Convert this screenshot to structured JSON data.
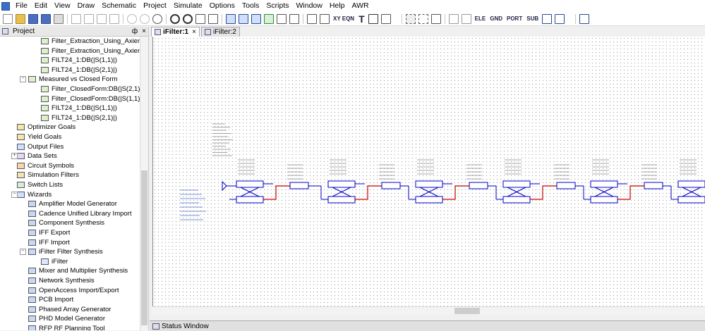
{
  "menu": [
    "File",
    "Edit",
    "View",
    "Draw",
    "Schematic",
    "Project",
    "Simulate",
    "Options",
    "Tools",
    "Scripts",
    "Window",
    "Help",
    "AWR"
  ],
  "toolbar": {
    "xy_label": "XY EQN",
    "text_label": "T",
    "ele_label": "ELE",
    "gnd_label": "GND",
    "port_label": "PORT",
    "sub_label": "SUB"
  },
  "project_panel": {
    "title": "Project",
    "pin": "ф",
    "close": "×",
    "tree": [
      {
        "label": "Filter_Extraction_Using_Axiem:DE",
        "icon": "graph-icon",
        "indent": 2
      },
      {
        "label": "Filter_Extraction_Using_Axiem:DE",
        "icon": "graph-icon",
        "indent": 2
      },
      {
        "label": "FILT24_1:DB(|S(1,1)|)",
        "icon": "graph-icon",
        "indent": 2
      },
      {
        "label": "FILT24_1:DB(|S(2,1)|)",
        "icon": "graph-icon",
        "indent": 2
      },
      {
        "label": "Measured vs Closed Form",
        "icon": "graph-icon",
        "indent": 1,
        "expander": "−"
      },
      {
        "label": "Filter_ClosedForm:DB(|S(2,1)|)",
        "icon": "graph-icon",
        "indent": 2
      },
      {
        "label": "Filter_ClosedForm:DB(|S(1,1)|)",
        "icon": "graph-icon",
        "indent": 2
      },
      {
        "label": "FILT24_1:DB(|S(1,1)|)",
        "icon": "graph-icon",
        "indent": 2
      },
      {
        "label": "FILT24_1:DB(|S(2,1)|)",
        "icon": "graph-icon",
        "indent": 2
      },
      {
        "label": "Optimizer Goals",
        "icon": "goals-icon",
        "indent": 0
      },
      {
        "label": "Yield Goals",
        "icon": "goals-icon",
        "indent": 0
      },
      {
        "label": "Output Files",
        "icon": "files-icon",
        "indent": 0
      },
      {
        "label": "Data Sets",
        "icon": "dataset-icon",
        "indent": 0,
        "expander": "+"
      },
      {
        "label": "Circuit Symbols",
        "icon": "symbol-icon",
        "indent": 0
      },
      {
        "label": "Simulation Filters",
        "icon": "filter-icon",
        "indent": 0
      },
      {
        "label": "Switch Lists",
        "icon": "list-icon",
        "indent": 0
      },
      {
        "label": "Wizards",
        "icon": "wizard-icon",
        "indent": 0,
        "expander": "−"
      },
      {
        "label": "Amplifier Model Generator",
        "icon": "wizard-item-icon",
        "indent": 1
      },
      {
        "label": "Cadence Unified Library Import",
        "icon": "wizard-item-icon",
        "indent": 1
      },
      {
        "label": "Component Synthesis",
        "icon": "wizard-item-icon",
        "indent": 1
      },
      {
        "label": "IFF Export",
        "icon": "wizard-item-icon",
        "indent": 1
      },
      {
        "label": "IFF Import",
        "icon": "wizard-item-icon",
        "indent": 1
      },
      {
        "label": "iFilter Filter Synthesis",
        "icon": "wizard-item-icon",
        "indent": 1,
        "expander": "−"
      },
      {
        "label": "iFilter",
        "icon": "ifilter-icon",
        "indent": 2
      },
      {
        "label": "Mixer and Multiplier Synthesis",
        "icon": "wizard-item-icon",
        "indent": 1
      },
      {
        "label": "Network Synthesis",
        "icon": "wizard-item-icon",
        "indent": 1
      },
      {
        "label": "OpenAccess Import/Export",
        "icon": "wizard-item-icon",
        "indent": 1
      },
      {
        "label": "PCB Import",
        "icon": "wizard-item-icon",
        "indent": 1
      },
      {
        "label": "Phased Array Generator",
        "icon": "wizard-item-icon",
        "indent": 1
      },
      {
        "label": "PHD Model Generator",
        "icon": "wizard-item-icon",
        "indent": 1
      },
      {
        "label": "RFP RF Planning Tool",
        "icon": "wizard-item-icon",
        "indent": 1
      }
    ]
  },
  "tabs": [
    {
      "label": "iFilter:1",
      "active": true,
      "close": "×"
    },
    {
      "label": "iFilter:2",
      "active": false
    }
  ],
  "status_window": {
    "title": "Status Window"
  },
  "colors": {
    "accent": "#3a6fc4",
    "wire_red": "#cc0000",
    "element_blue": "#0000cc"
  }
}
